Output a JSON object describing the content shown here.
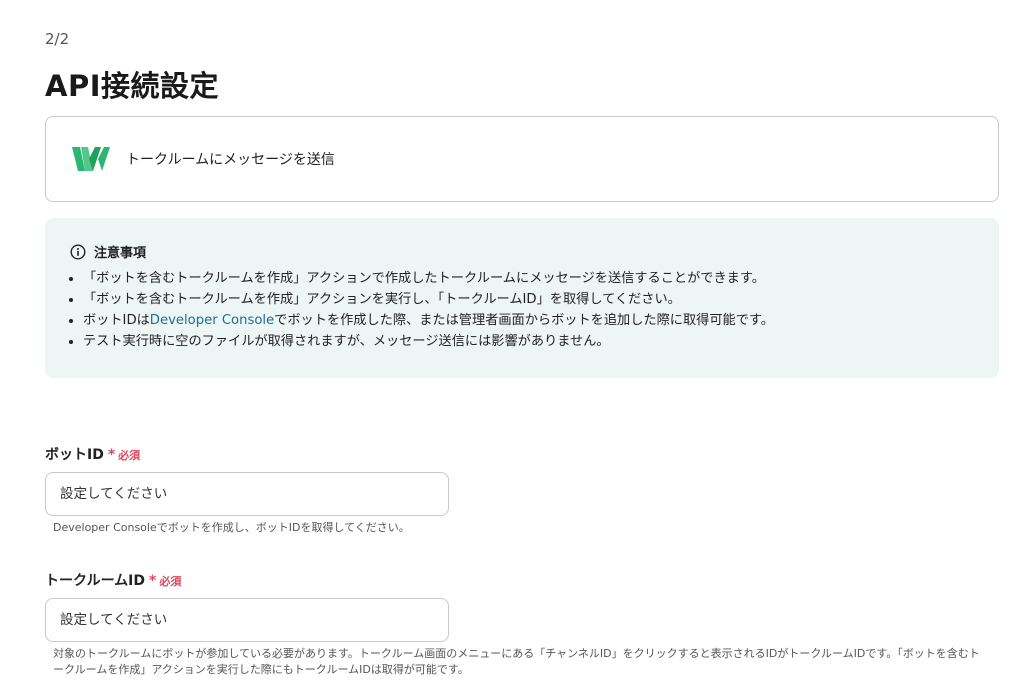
{
  "header": {
    "step": "2/2",
    "title": "API接続設定"
  },
  "action": {
    "label": "トークルームにメッセージを送信",
    "logo_icon": "line-works-logo-icon",
    "logo_colors": [
      "#2bb673",
      "#1fa15d"
    ]
  },
  "notice": {
    "title": "注意事項",
    "icon": "info-circle-icon",
    "items": [
      "「ボットを含むトークルームを作成」アクションで作成したトークルームにメッセージを送信することができます。",
      "「ボットを含むトークルームを作成」アクションを実行し、「トークルームID」を取得してください。",
      "テスト実行時に空のファイルが取得されますが、メッセージ送信には影響がありません。"
    ],
    "item3_prefix": "ボットIDは",
    "item3_link": "Developer Console",
    "item3_suffix": "でボットを作成した際、または管理者画面からボットを追加した際に取得可能です。"
  },
  "fields": {
    "bot_id": {
      "label": "ボットID",
      "required_mark": "*",
      "required_text": "必須",
      "placeholder": "設定してください",
      "help": "Developer Consoleでボットを作成し、ボットIDを取得してください。"
    },
    "room_id": {
      "label": "トークルームID",
      "required_mark": "*",
      "required_text": "必須",
      "placeholder": "設定してください",
      "help_line1": "対象のトークルームにボットが参加している必要があります。トークルーム画面のメニューにある「チャンネルID」をクリックすると表示されるIDがトークルームIDです。「ボットを含むト",
      "help_line2": "ークルームを作成」アクションを実行した際にもトークルームIDは取得が可能です。"
    }
  },
  "colors": {
    "required": "#e2465d",
    "link": "#1f6f8b",
    "notice_bg": "#eef6f5"
  }
}
